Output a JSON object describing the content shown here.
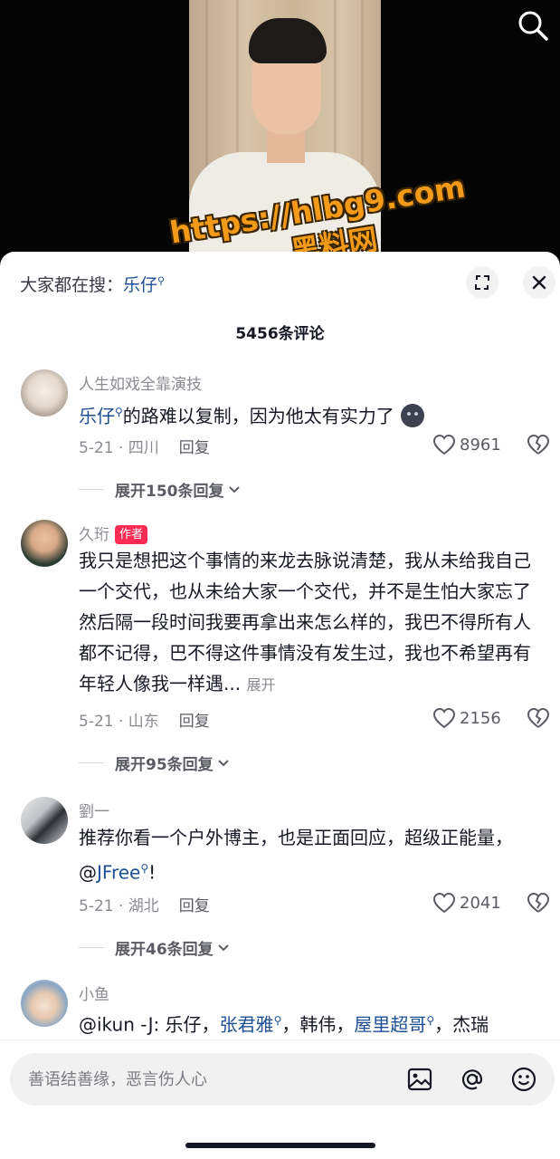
{
  "search_bar": {
    "prefix": "大家都在搜：",
    "term": "乐仔"
  },
  "watermark": {
    "url": "https://hlbg9.com",
    "name": "黑料网"
  },
  "comment_count": "5456条评论",
  "comments": [
    {
      "username": "人生如戏全靠演技",
      "text_link": "乐仔",
      "text": "的路难以复制，因为他太有实力了",
      "date_location": "5-21 · 四川",
      "reply_label": "回复",
      "likes": "8961",
      "expand_replies": "展开150条回复"
    },
    {
      "username": "久珩",
      "author_badge": "作者",
      "text": "我只是想把这个事情的来龙去脉说清楚，我从未给我自己一个交代，也从未给大家一个交代，并不是生怕大家忘了然后隔一段时间我要再拿出来怎么样的，我巴不得所有人都不记得，巴不得这件事情没有发生过，我也不希望再有年轻人像我一样遇...",
      "more": "展开",
      "date_location": "5-21 · 山东",
      "reply_label": "回复",
      "likes": "2156",
      "expand_replies": "展开95条回复"
    },
    {
      "username": "劉一",
      "text": "推荐你看一个户外博主，也是正面回应，超级正能量，",
      "mention_prefix": "@",
      "mention_link": "JFree",
      "mention_suffix": "!",
      "date_location": "5-21 · 湖北",
      "reply_label": "回复",
      "likes": "2041",
      "expand_replies": "展开46条回复"
    },
    {
      "username": "小鱼",
      "text_a": "@ikun -J: 乐仔，",
      "link_a": "张君雅",
      "text_b": "，韩伟，",
      "link_b": "屋里超哥",
      "text_c": "，杰瑞"
    }
  ],
  "input": {
    "placeholder": "善语结善缘，恶言伤人心"
  },
  "icons": {
    "search": "search-icon",
    "expand": "expand-icon",
    "close": "close-icon",
    "like": "heart-icon",
    "dislike": "broken-heart-icon",
    "image": "image-icon",
    "mention": "at-icon",
    "emoji": "emoji-icon"
  },
  "colors": {
    "link": "#1d4f94",
    "author_badge": "#fe2c55",
    "watermark": "#f39b19"
  }
}
